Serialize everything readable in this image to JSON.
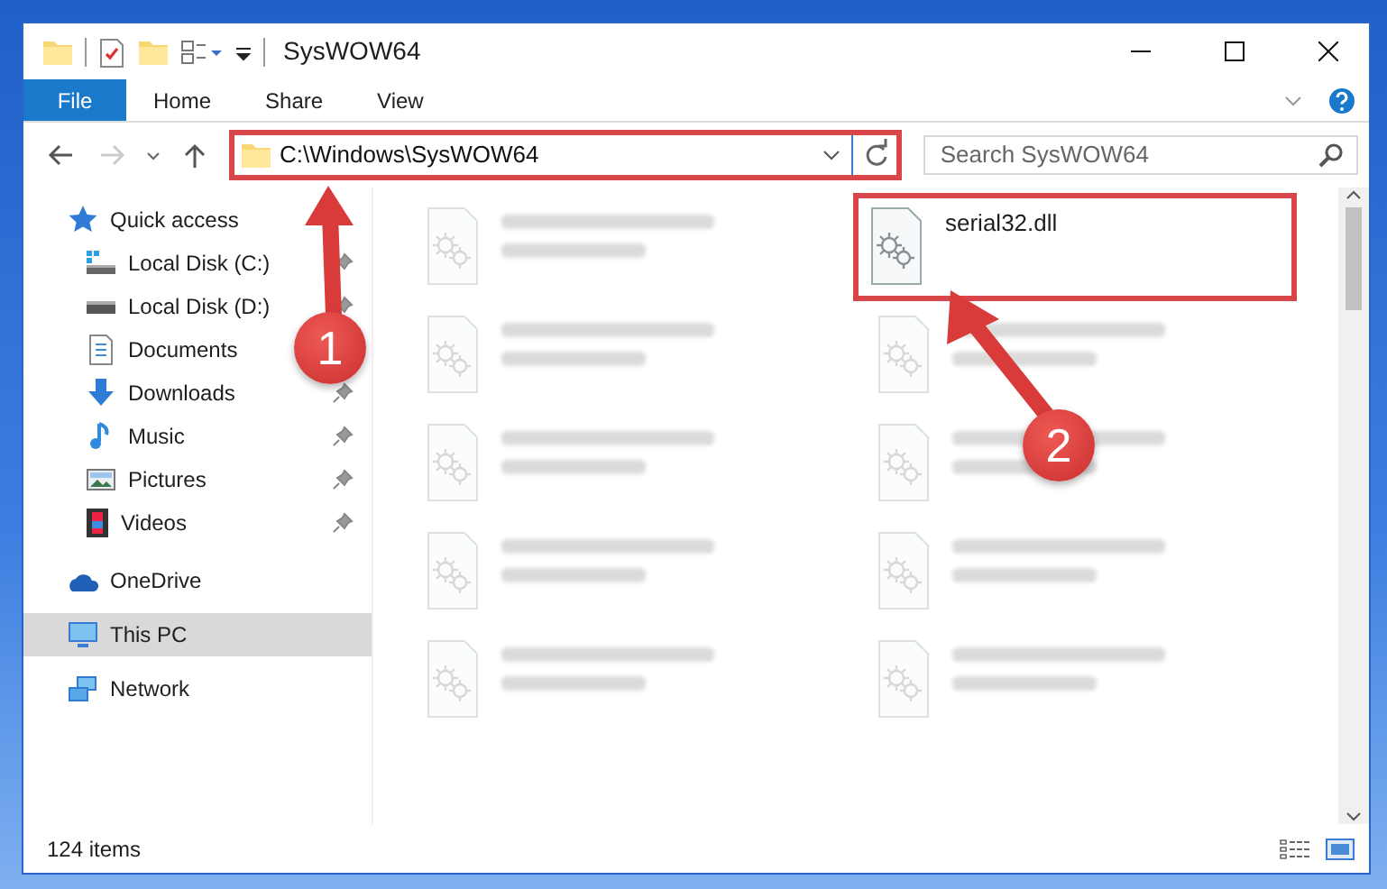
{
  "window": {
    "title": "SysWOW64"
  },
  "ribbon_tabs": [
    {
      "label": "File",
      "selected": true
    },
    {
      "label": "Home",
      "selected": false
    },
    {
      "label": "Share",
      "selected": false
    },
    {
      "label": "View",
      "selected": false
    }
  ],
  "address": {
    "path": "C:\\Windows\\SysWOW64",
    "highlighted": true
  },
  "search": {
    "placeholder": "Search SysWOW64"
  },
  "sidebar": {
    "items": [
      {
        "label": "Quick access",
        "kind": "quick",
        "selected": false,
        "children": [
          {
            "label": "Local Disk (C:)",
            "kind": "sysdrive",
            "pinned": true,
            "selected": false
          },
          {
            "label": "Local Disk (D:)",
            "kind": "drive",
            "pinned": true,
            "selected": false
          },
          {
            "label": "Documents",
            "kind": "documents",
            "selected": false
          },
          {
            "label": "Downloads",
            "kind": "downloads",
            "pinned": true,
            "selected": false
          },
          {
            "label": "Music",
            "kind": "music",
            "pinned": true,
            "selected": false
          },
          {
            "label": "Pictures",
            "kind": "pictures",
            "pinned": true,
            "selected": false
          },
          {
            "label": "Videos",
            "kind": "videos",
            "pinned": true,
            "selected": false
          }
        ]
      },
      {
        "label": "OneDrive",
        "kind": "cloud",
        "selected": false
      },
      {
        "label": "This PC",
        "kind": "pc",
        "selected": true
      },
      {
        "label": "Network",
        "kind": "network",
        "selected": false
      }
    ]
  },
  "files": [
    {
      "blurred": true,
      "highlighted": false
    },
    {
      "name": "serial32.dll",
      "blurred": false,
      "highlighted": true
    },
    {
      "blurred": true,
      "highlighted": false
    },
    {
      "blurred": true,
      "highlighted": false
    },
    {
      "blurred": true,
      "highlighted": false
    },
    {
      "blurred": true,
      "highlighted": false
    },
    {
      "blurred": true,
      "highlighted": false
    },
    {
      "blurred": true,
      "highlighted": false
    },
    {
      "blurred": true,
      "highlighted": false
    },
    {
      "blurred": true,
      "highlighted": false
    }
  ],
  "annotations": [
    {
      "number": "1"
    },
    {
      "number": "2"
    }
  ],
  "status_bar": {
    "count": "124 items"
  }
}
